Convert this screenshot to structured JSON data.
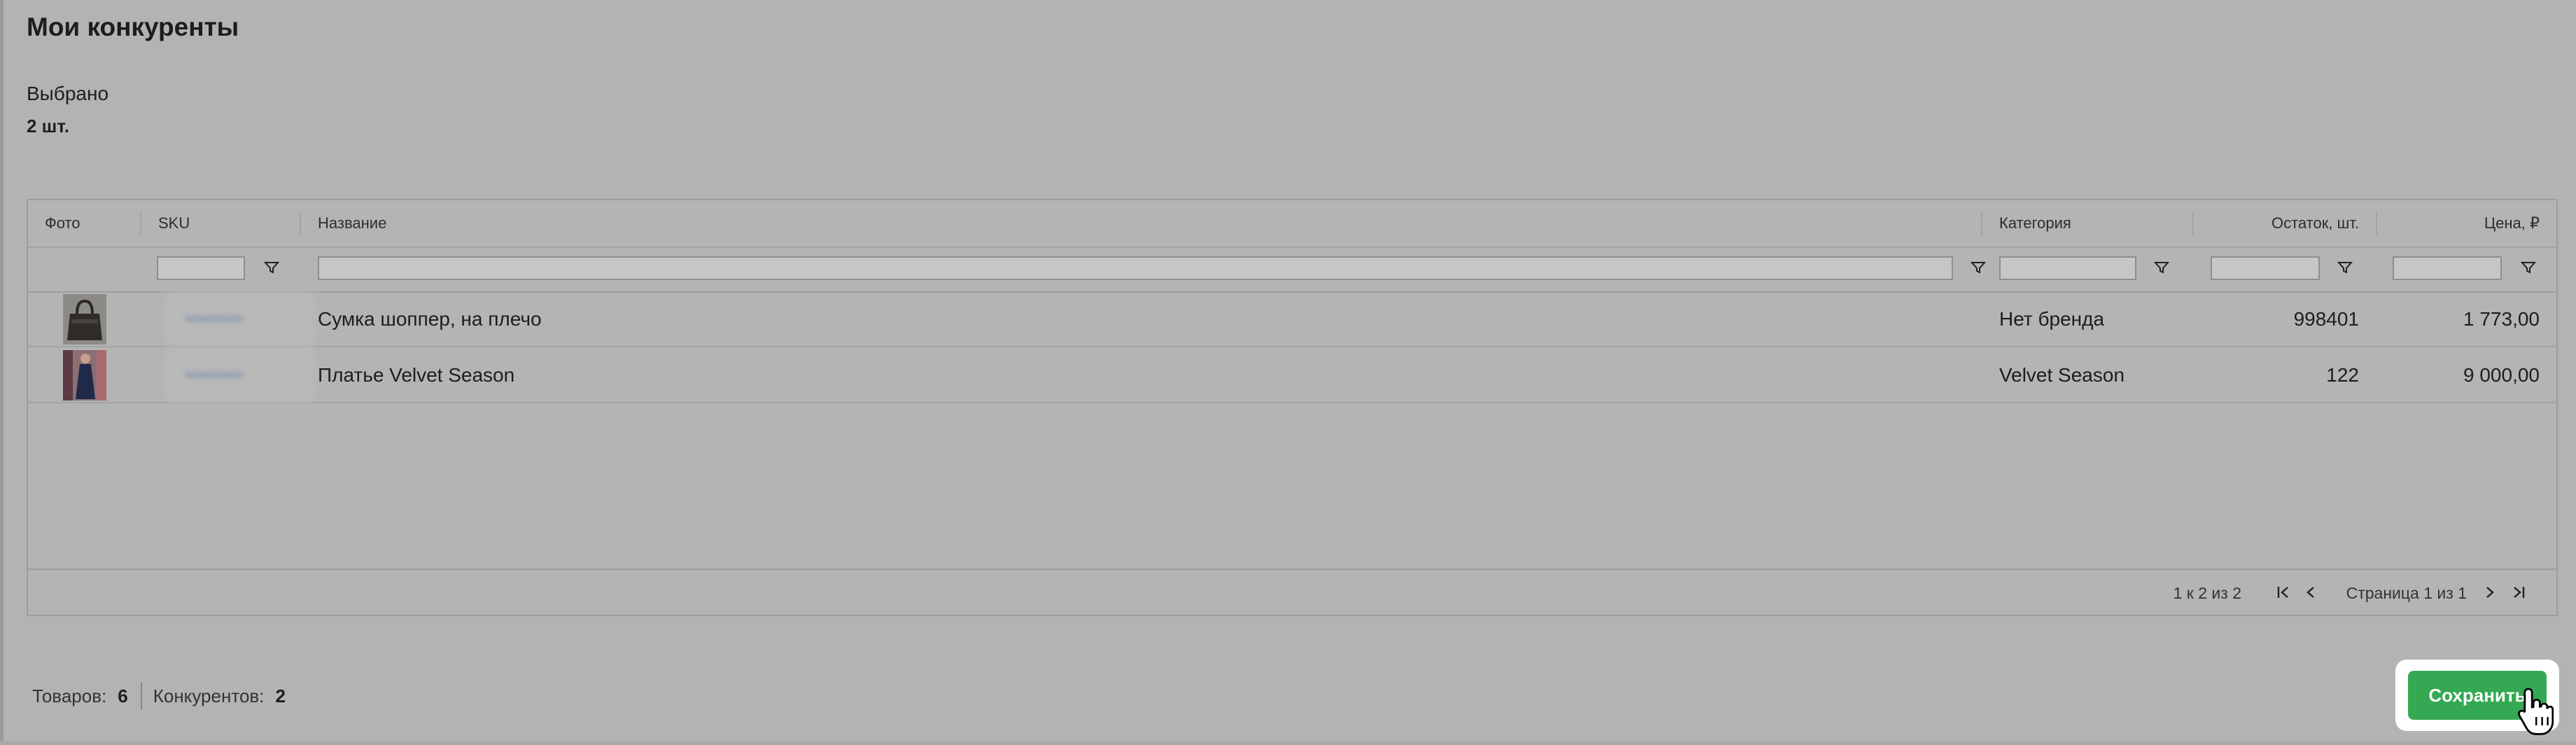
{
  "page_title": "Мои конкуренты",
  "selected": {
    "label": "Выбрано",
    "value": "2 шт."
  },
  "grid": {
    "columns": {
      "photo": "Фото",
      "sku": "SKU",
      "name": "Название",
      "category": "Категория",
      "stock": "Остаток, шт.",
      "price": "Цена, ₽"
    },
    "rows": [
      {
        "sku": "••••••••••",
        "name": "Сумка шоппер, на плечо",
        "category": "Нет бренда",
        "stock": "998401",
        "price": "1 773,00"
      },
      {
        "sku": "••••••••••",
        "name": "Платье Velvet Season",
        "category": "Velvet Season",
        "stock": "122",
        "price": "9 000,00"
      }
    ],
    "pager": {
      "count": "1 к 2 из 2",
      "page_text": "Страница 1 из 1"
    }
  },
  "footer": {
    "products_label": "Товаров:",
    "products_value": "6",
    "competitors_label": "Конкурентов:",
    "competitors_value": "2"
  },
  "save_label": "Сохранить",
  "colors": {
    "accent": "#34a853",
    "overlay": "#b3b3b3"
  },
  "icons": {
    "filter": "filter-icon",
    "first": "first-page-icon",
    "prev": "prev-page-icon",
    "next": "next-page-icon",
    "last": "last-page-icon",
    "cursor": "hand-pointer-icon"
  }
}
